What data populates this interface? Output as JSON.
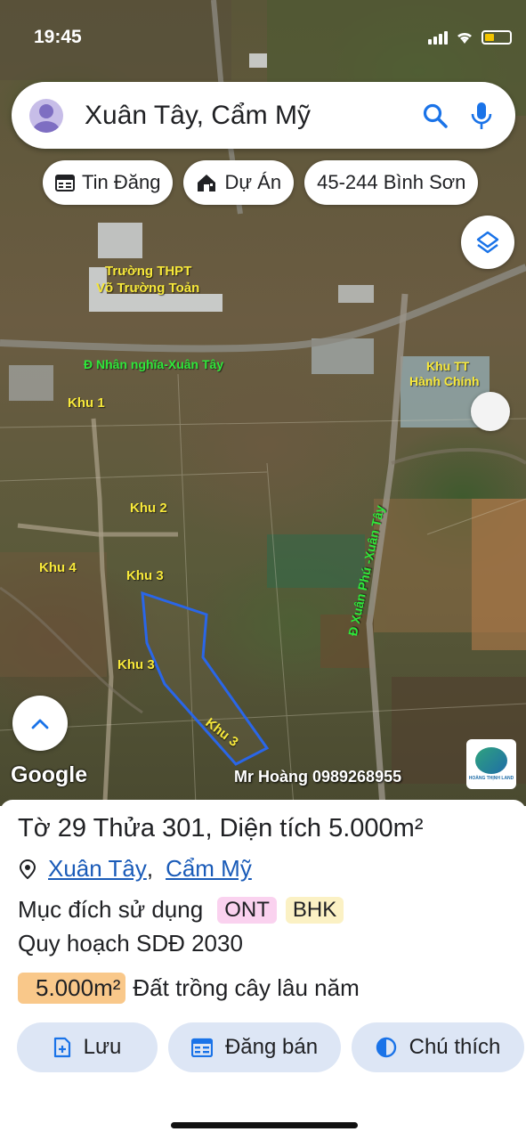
{
  "status_bar": {
    "time": "19:45"
  },
  "search": {
    "value": "Xuân Tây, Cẩm Mỹ"
  },
  "chips": [
    {
      "label": "Tin Đăng",
      "icon": "calendar-icon"
    },
    {
      "label": "Dự Án",
      "icon": "house-icon"
    },
    {
      "label": "45-244 Bình Sơn",
      "icon": ""
    }
  ],
  "map_labels": {
    "school": "Trường THPT",
    "school_name": "Võ Trường Toản",
    "road1": "Đ Nhân nghĩa-Xuân Tây",
    "admin1": "Khu TT",
    "admin2": "Hành Chính",
    "khu1": "Khu 1",
    "khu2": "Khu 2",
    "khu3a": "Khu 3",
    "khu3b": "Khu 3",
    "khu3c": "Khu 3",
    "khu4": "Khu 4",
    "road2": "Đ Xuân Phú -Xuân Tây"
  },
  "attribution": "Google",
  "watermark": "Mr Hoàng 0989268955",
  "brand": "HOÀNG THỊNH LAND",
  "parcel": {
    "sheet_label": "Tờ",
    "sheet_no": "29",
    "lot_label": "Thửa",
    "lot_no": "301",
    "area_label": "Diện tích",
    "area_value": "5.000",
    "area_unit": "m²",
    "commune": "Xuân Tây",
    "district": "Cẩm Mỹ",
    "purpose_label": "Mục đích sử dụng",
    "tags": [
      "ONT",
      "BHK"
    ],
    "plan_label": "Quy hoạch SDĐ 2030",
    "plan_area": "5.000m²",
    "plan_use": "Đất trồng cây lâu năm"
  },
  "actions": [
    {
      "label": "Lưu",
      "icon": "add-document-icon"
    },
    {
      "label": "Đăng bán",
      "icon": "calendar-icon"
    },
    {
      "label": "Chú thích",
      "icon": "contrast-icon"
    }
  ],
  "colors": {
    "accent_blue": "#1a73e8",
    "map_label_yellow": "#f7e83a",
    "map_label_green": "#2ee83a",
    "parcel_outline": "#2a66e8",
    "tag_ont": "#fad2ef",
    "tag_bhk": "#fbf1c4",
    "area_badge": "#f9c88a",
    "action_button": "#dde6f5"
  }
}
